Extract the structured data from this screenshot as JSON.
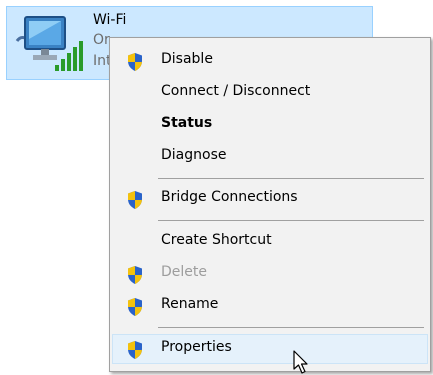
{
  "adapter": {
    "name": "Wi-Fi",
    "status_partial": "Or",
    "detail_partial": "Int",
    "icon": "wifi-network-adapter-icon"
  },
  "menu": {
    "items": [
      {
        "label": "Disable",
        "icon": "shield-icon"
      },
      {
        "label": "Connect / Disconnect",
        "icon": ""
      },
      {
        "label": "Status",
        "icon": "",
        "bold": true
      },
      {
        "label": "Diagnose",
        "icon": ""
      },
      {
        "label": "Bridge Connections",
        "icon": "shield-icon"
      },
      {
        "label": "Create Shortcut",
        "icon": ""
      },
      {
        "label": "Delete",
        "icon": "shield-icon",
        "disabled": true
      },
      {
        "label": "Rename",
        "icon": "shield-icon"
      },
      {
        "label": "Properties",
        "icon": "shield-icon",
        "hovered": true
      }
    ]
  },
  "colors": {
    "selection_bg": "#cce8ff",
    "menu_bg": "#f2f2f2",
    "hover_bg": "#e5f1fb",
    "disabled_text": "#9d9d9d",
    "shield_blue": "#2a63c9",
    "shield_yellow": "#f4c20d"
  }
}
